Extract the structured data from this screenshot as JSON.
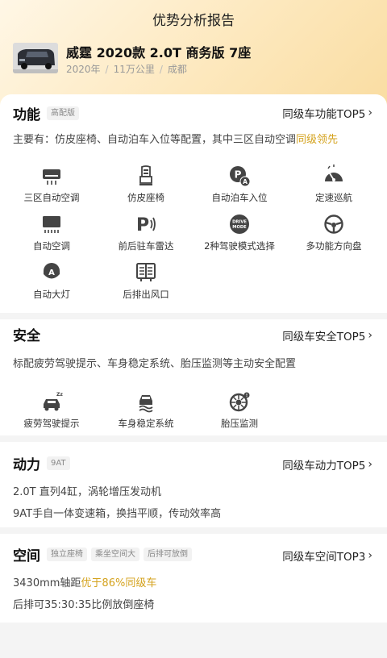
{
  "header": {
    "title": "优势分析报告"
  },
  "car": {
    "title": "威霆 2020款 2.0T 商务版 7座",
    "year": "2020年",
    "mileage": "11万公里",
    "city": "成都"
  },
  "sections": {
    "function": {
      "title": "功能",
      "tag": "高配版",
      "rank": "同级车功能TOP5",
      "desc_prefix": "主要有：仿皮座椅、自动泊车入位等配置，其中三区自动空调",
      "desc_highlight": "同级领先",
      "features": [
        {
          "label": "三区自动空调",
          "icon": "air-conditioner-icon"
        },
        {
          "label": "仿皮座椅",
          "icon": "seat-icon"
        },
        {
          "label": "自动泊车入位",
          "icon": "auto-parking-icon"
        },
        {
          "label": "定速巡航",
          "icon": "cruise-control-icon"
        },
        {
          "label": "自动空调",
          "icon": "auto-ac-icon"
        },
        {
          "label": "前后驻车雷达",
          "icon": "parking-radar-icon"
        },
        {
          "label": "2种驾驶模式选择",
          "icon": "drive-mode-icon"
        },
        {
          "label": "多功能方向盘",
          "icon": "steering-wheel-icon"
        },
        {
          "label": "自动大灯",
          "icon": "auto-headlight-icon"
        },
        {
          "label": "后排出风口",
          "icon": "rear-vent-icon"
        }
      ],
      "drive_mode_text": "DRIVE MODE"
    },
    "safety": {
      "title": "安全",
      "rank": "同级车安全TOP5",
      "desc": "标配疲劳驾驶提示、车身稳定系统、胎压监测等主动安全配置",
      "features": [
        {
          "label": "疲劳驾驶提示",
          "icon": "fatigue-warning-icon"
        },
        {
          "label": "车身稳定系统",
          "icon": "stability-control-icon"
        },
        {
          "label": "胎压监测",
          "icon": "tire-pressure-icon"
        }
      ]
    },
    "power": {
      "title": "动力",
      "tag": "9AT",
      "rank": "同级车动力TOP5",
      "lines": [
        "2.0T 直列4缸，涡轮增压发动机",
        "9AT手自一体变速箱，换挡平顺，传动效率高"
      ]
    },
    "space": {
      "title": "空间",
      "tags": [
        "独立座椅",
        "乘坐空间大",
        "后排可放倒"
      ],
      "rank": "同级车空间TOP3",
      "line1_prefix": "3430mm轴距",
      "line1_highlight": "优于86%同级车",
      "line2": "后排可35:30:35比例放倒座椅"
    }
  },
  "colors": {
    "gold": "#d4a21d",
    "icon": "#444444",
    "hero_start": "#fff7e6",
    "hero_end": "#f9dca0"
  }
}
